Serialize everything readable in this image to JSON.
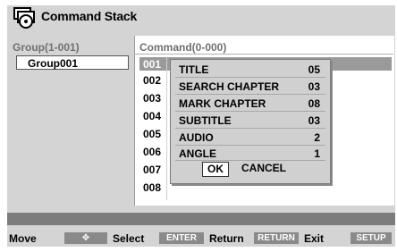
{
  "window": {
    "title": "Command Stack"
  },
  "left_panel": {
    "header": "Group(1-001)",
    "items": [
      "Group001"
    ]
  },
  "right_panel": {
    "header": "Command(0-000)",
    "rows": [
      "001",
      "002",
      "003",
      "004",
      "005",
      "006",
      "007",
      "008"
    ]
  },
  "popup": {
    "rows": [
      {
        "label": "TITLE",
        "value": "05"
      },
      {
        "label": "SEARCH CHAPTER",
        "value": "03"
      },
      {
        "label": "MARK CHAPTER",
        "value": "08"
      },
      {
        "label": "SUBTITLE",
        "value": "03"
      },
      {
        "label": "AUDIO",
        "value": "2"
      },
      {
        "label": "ANGLE",
        "value": "1"
      }
    ],
    "ok_label": "OK",
    "cancel_label": "CANCEL"
  },
  "footer": {
    "move_label": "Move",
    "move_key": "✥",
    "select_label": "Select",
    "select_key": "ENTER",
    "return_label": "Return",
    "return_key": "RETURN",
    "exit_label": "Exit",
    "exit_key": "SETUP"
  },
  "icons": {
    "title": "disc-stack-icon",
    "move": "four-way-arrow-icon"
  }
}
